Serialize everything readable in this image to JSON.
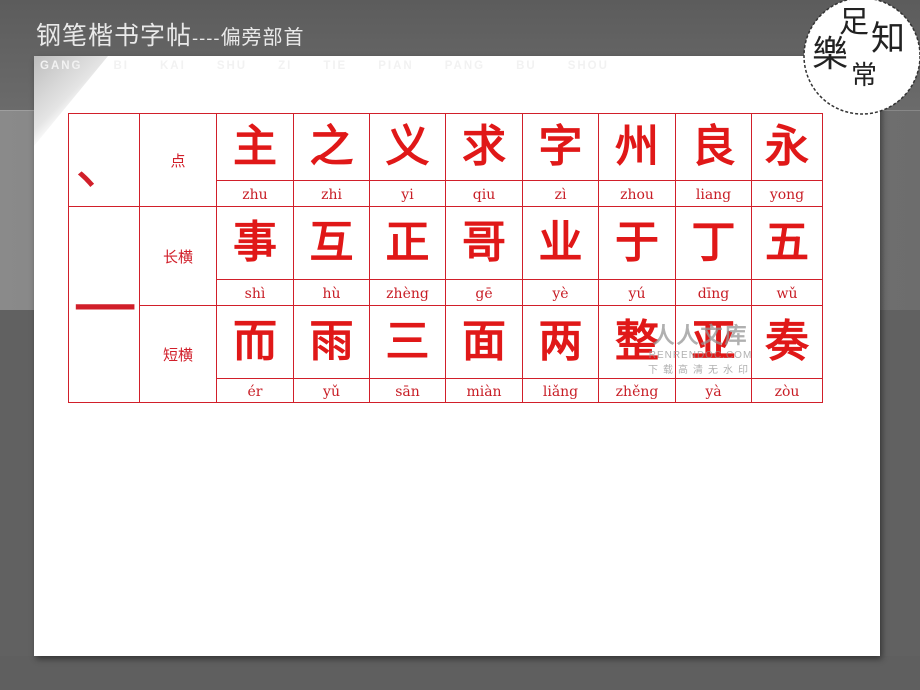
{
  "header": {
    "title_main": "钢笔楷书字帖",
    "title_sep": "----",
    "title_sub": "偏旁部首",
    "pinyin": [
      "GANG",
      "BI",
      "KAI",
      "SHU",
      "ZI",
      "TIE",
      "PIAN",
      "PANG",
      "BU",
      "SHOU"
    ]
  },
  "stamp": {
    "chars": [
      "知",
      "足",
      "常",
      "樂"
    ]
  },
  "table": {
    "groups": [
      {
        "stroke": "、",
        "rows": [
          {
            "name": "点",
            "chars": [
              "主",
              "之",
              "义",
              "求",
              "字",
              "州",
              "良",
              "永"
            ],
            "pinyin": [
              "zhu",
              "zhi",
              "yi",
              "qiu",
              "zì",
              "zhou",
              "liang",
              "yong"
            ]
          }
        ]
      },
      {
        "stroke": "一",
        "rows": [
          {
            "name": "长横",
            "chars": [
              "事",
              "互",
              "正",
              "哥",
              "业",
              "于",
              "丁",
              "五"
            ],
            "pinyin": [
              "shì",
              "hù",
              "zhèng",
              "gē",
              "yè",
              "yú",
              "dīng",
              "wǔ"
            ]
          },
          {
            "name": "短横",
            "chars": [
              "而",
              "雨",
              "三",
              "面",
              "两",
              "整",
              "亚",
              "奏"
            ],
            "pinyin": [
              "ér",
              "yǔ",
              "sān",
              "miàn",
              "liǎng",
              "zhěng",
              "yà",
              "zòu"
            ]
          }
        ]
      }
    ]
  },
  "watermark": {
    "line1": "人人文库",
    "line2": "RENRENDOC.COM",
    "line3": "下载高清无水印"
  }
}
